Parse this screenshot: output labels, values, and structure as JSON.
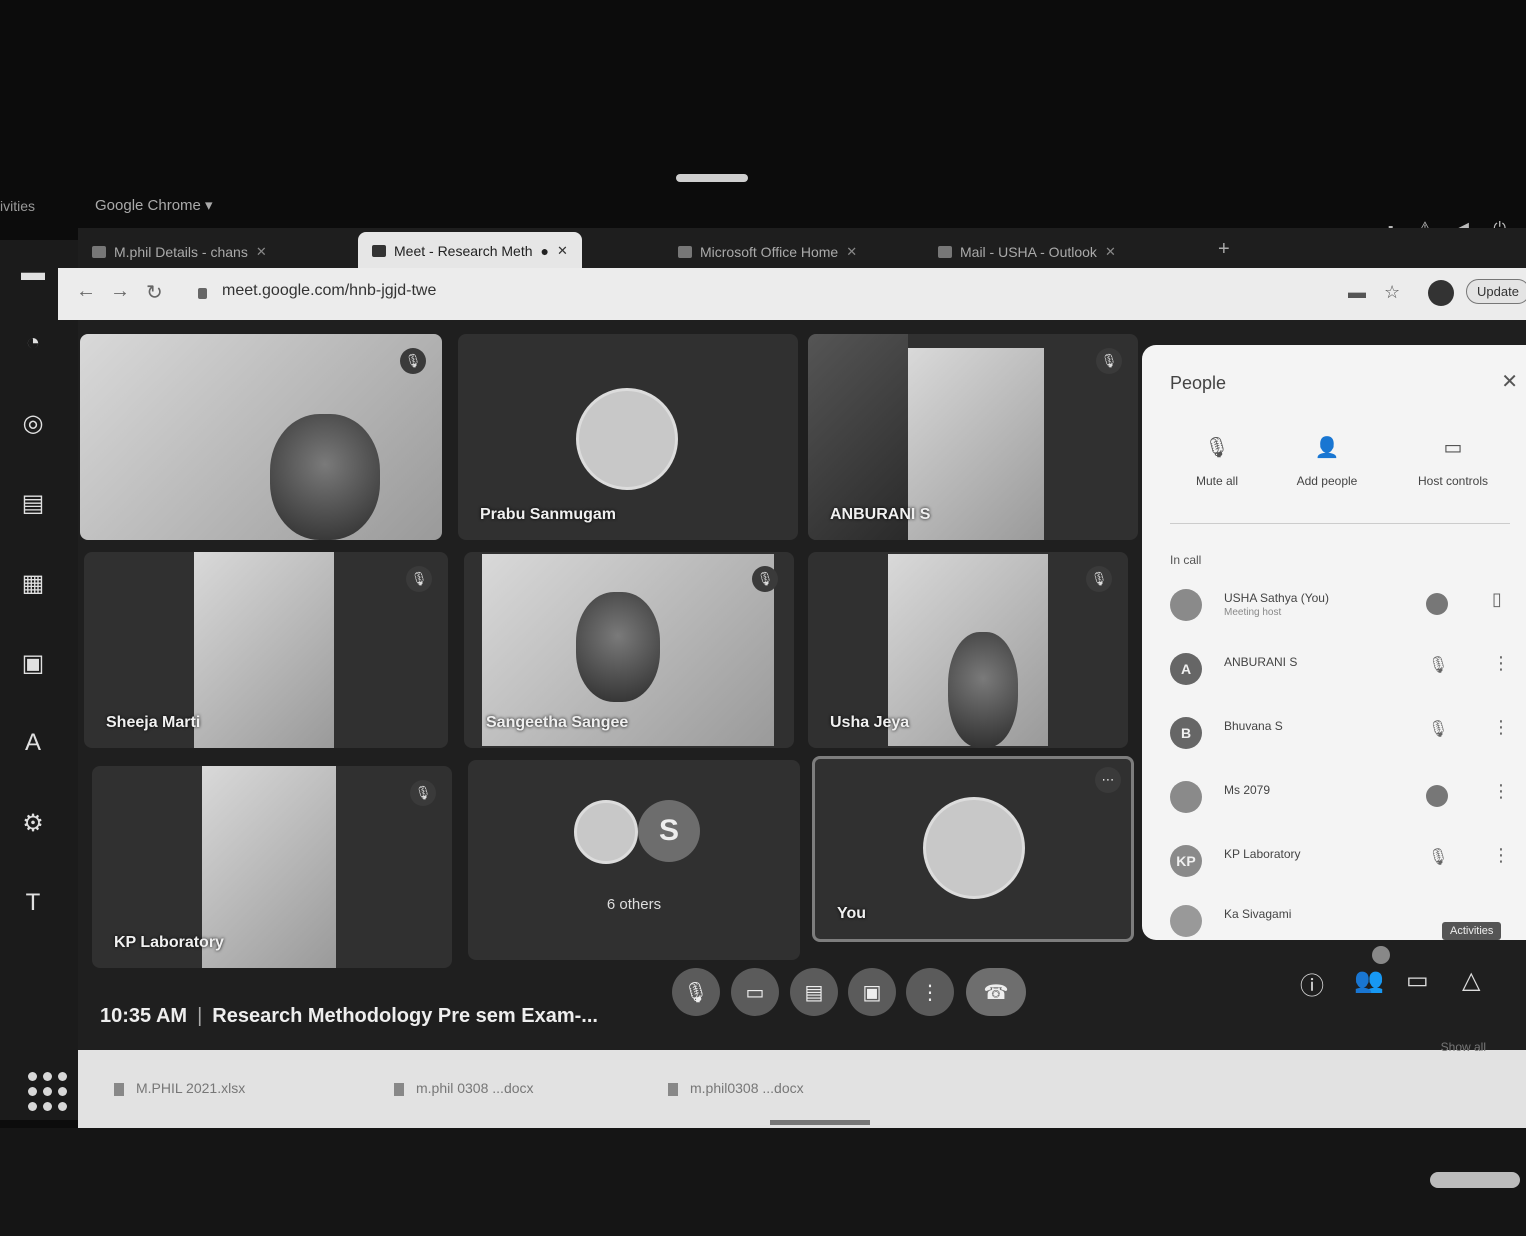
{
  "desktop": {
    "activities": "ivities",
    "app_menu": "Google Chrome ▾"
  },
  "browser": {
    "tabs": [
      {
        "label": "M.phil Details - chans",
        "active": false
      },
      {
        "label": "Meet - Research Meth",
        "active": true
      },
      {
        "label": "Microsoft Office Home",
        "active": false
      },
      {
        "label": "Mail - USHA - Outlook",
        "active": false
      }
    ],
    "url": "meet.google.com/hnb-jgjd-twe",
    "update_label": "Update"
  },
  "meet": {
    "tiles": [
      {
        "name": "",
        "type": "video-light"
      },
      {
        "name": "Prabu Sanmugam",
        "type": "avatar"
      },
      {
        "name": "ANBURANI S",
        "type": "video-light"
      },
      {
        "name": "Sheeja Marti",
        "type": "video-light"
      },
      {
        "name": "Sangeetha Sangee",
        "type": "video-light"
      },
      {
        "name": "Usha Jeya",
        "type": "video-light"
      },
      {
        "name": "KP Laboratory",
        "type": "video-light"
      },
      {
        "name": "6 others",
        "type": "others",
        "letter": "S"
      },
      {
        "name": "You",
        "type": "self"
      }
    ],
    "time": "10:35 AM",
    "meeting_title": "Research Methodology Pre sem Exam-..."
  },
  "people_panel": {
    "title": "People",
    "actions": [
      {
        "label": "Mute all"
      },
      {
        "label": "Add people"
      },
      {
        "label": "Host controls"
      }
    ],
    "section": "In call",
    "participants": [
      {
        "initial": "",
        "name": "USHA Sathya (You)",
        "sub": "Meeting host"
      },
      {
        "initial": "A",
        "name": "ANBURANI S"
      },
      {
        "initial": "B",
        "name": "Bhuvana S"
      },
      {
        "initial": "",
        "name": "Ms 2079"
      },
      {
        "initial": "KP",
        "name": "KP Laboratory"
      },
      {
        "initial": "",
        "name": "Ka Sivagami"
      }
    ],
    "activities_tooltip": "Activities"
  },
  "downloads": {
    "items": [
      "M.PHIL 2021.xlsx",
      "m.phil 0308 ...docx",
      "m.phil0308 ...docx"
    ],
    "show_all": "Show all"
  }
}
